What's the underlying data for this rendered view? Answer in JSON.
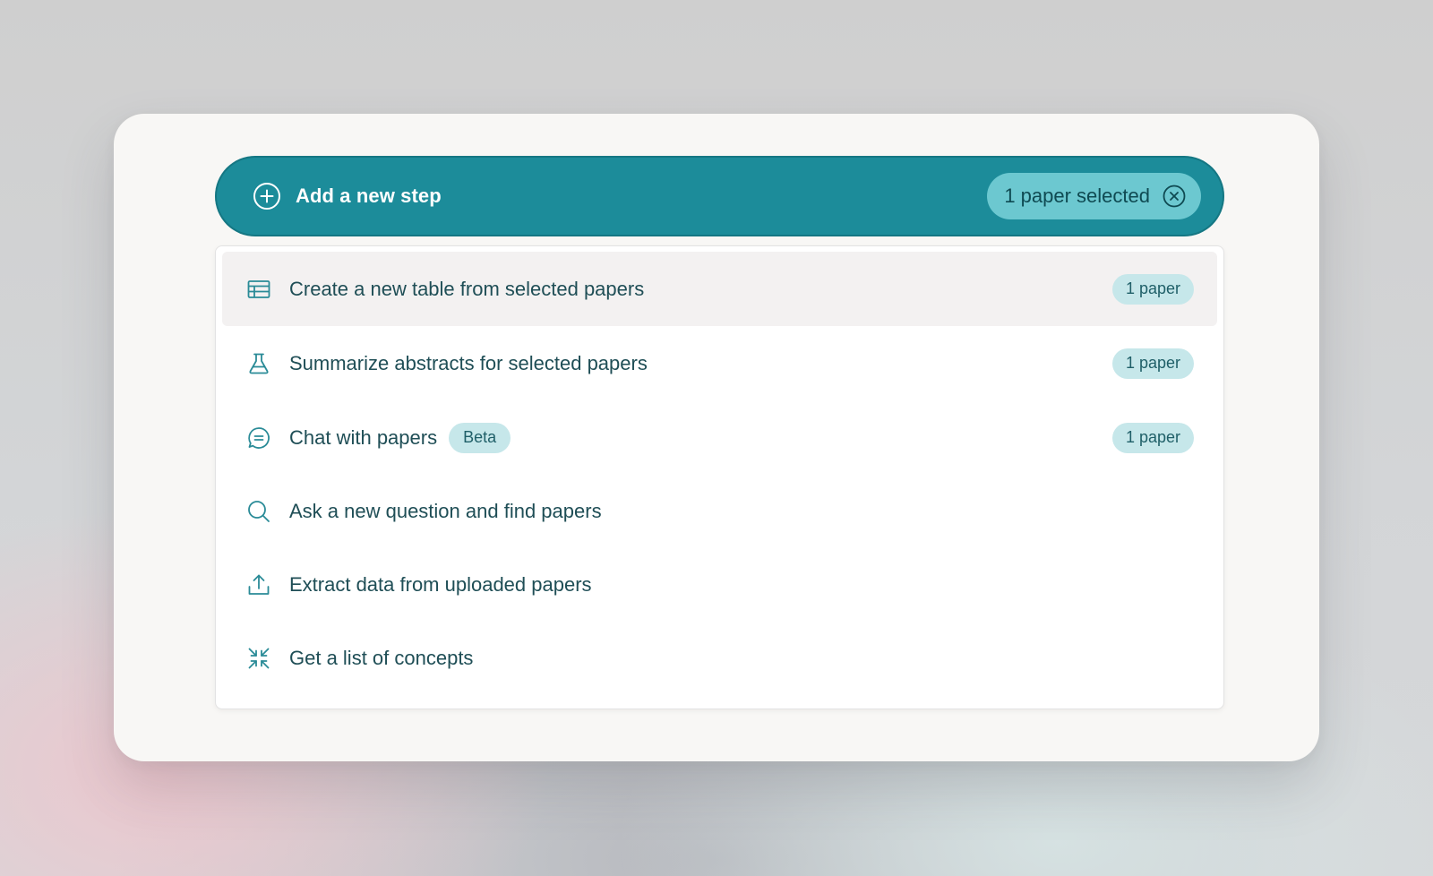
{
  "header": {
    "title": "Add a new step",
    "icon": "plus-circle-icon",
    "selection_chip": {
      "label": "1 paper selected",
      "clear_icon": "close-circle-icon"
    },
    "colors": {
      "background": "#1c8c9a",
      "chip": "#6cc8d0"
    }
  },
  "menu": {
    "items": [
      {
        "label": "Create a new table from selected papers",
        "icon": "table-icon",
        "count": "1 paper",
        "active": true
      },
      {
        "label": "Summarize abstracts for selected papers",
        "icon": "flask-icon",
        "count": "1 paper"
      },
      {
        "label": "Chat with papers",
        "icon": "chat-bubble-icon",
        "badge": "Beta",
        "count": "1 paper"
      },
      {
        "label": "Ask a new question and find papers",
        "icon": "search-icon"
      },
      {
        "label": "Extract data from uploaded papers",
        "icon": "upload-icon"
      },
      {
        "label": "Get a list of concepts",
        "icon": "compress-arrows-icon"
      }
    ]
  }
}
